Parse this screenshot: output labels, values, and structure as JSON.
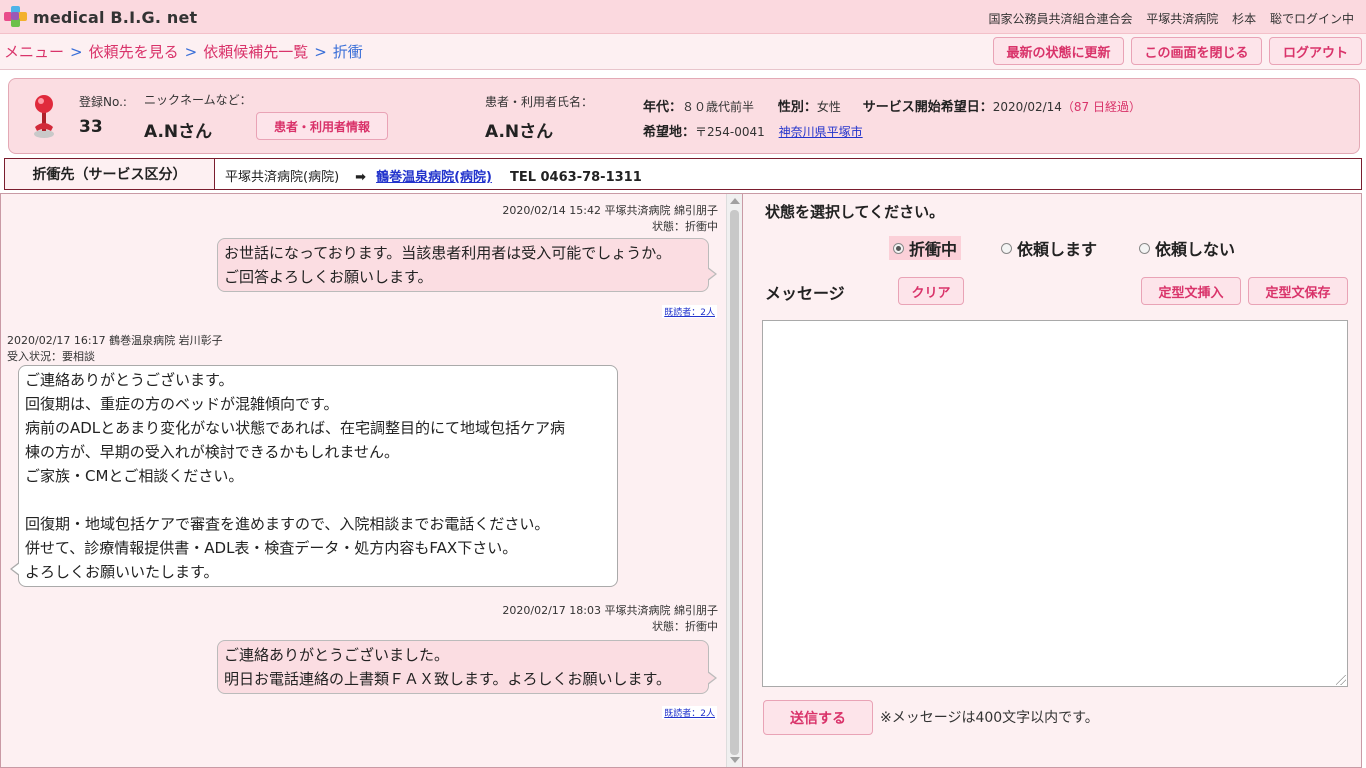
{
  "header": {
    "logo_text": "medical B.I.G. net",
    "org": "国家公務員共済組合連合会",
    "hospital": "平塚共済病院",
    "user": "杉本",
    "status": "聡でログイン中"
  },
  "breadcrumb": {
    "items": [
      "メニュー",
      "依頼先を見る",
      "依頼候補先一覧"
    ],
    "separator": ">",
    "current": "折衝"
  },
  "nav_buttons": {
    "refresh": "最新の状態に更新",
    "close": "この画面を閉じる",
    "logout": "ログアウト"
  },
  "patient": {
    "reg_label": "登録No.:",
    "reg_no": "33",
    "nick_label": "ニックネームなど：",
    "nickname": "A.Nさん",
    "info_button": "患者・利用者情報",
    "name_label": "患者・利用者氏名：",
    "name": "A.Nさん",
    "age_label": "年代：",
    "age": "８０歳代前半",
    "sex_label": "性別：",
    "sex": "女性",
    "start_label": "サービス開始希望日：",
    "start_date": "2020/02/14",
    "elapsed": "（87 日経過）",
    "place_label": "希望地：",
    "postal": "〒254-0041",
    "place": "神奈川県平塚市"
  },
  "negotiation": {
    "label": "折衝先（サービス区分）",
    "from": "平塚共済病院(病院)",
    "arrow": "➡",
    "to": "鶴巻温泉病院(病院)",
    "tel": "TEL 0463-78-1311"
  },
  "messages": [
    {
      "meta1": "2020/02/14 15:42  平塚共済病院 綿引朋子",
      "meta2": "状態：折衝中",
      "lines": [
        "お世話になっております。当該患者利用者は受入可能でしょうか。",
        "ご回答よろしくお願いします。"
      ],
      "readers": "既読者：2人"
    },
    {
      "meta1": "2020/02/17 16:17  鶴巻温泉病院 岩川彰子",
      "meta2": "受入状況：要相談",
      "lines": [
        "ご連絡ありがとうございます。",
        "回復期は、重症の方のベッドが混雑傾向です。",
        "病前のADLとあまり変化がない状態であれば、在宅調整目的にて地域包括ケア病",
        "棟の方が、早期の受入れが検討できるかもしれません。",
        "ご家族・CMとご相談ください。",
        "",
        "回復期・地域包括ケアで審査を進めますので、入院相談までお電話ください。",
        "併せて、診療情報提供書・ADL表・検査データ・処方内容もFAX下さい。",
        "よろしくお願いいたします。"
      ]
    },
    {
      "meta1": "2020/02/17 18:03  平塚共済病院 綿引朋子",
      "meta2": "状態：折衝中",
      "lines": [
        "ご連絡ありがとうございました。",
        "明日お電話連絡の上書類ＦＡＸ致します。よろしくお願いします。"
      ],
      "readers": "既読者：2人"
    }
  ],
  "reply": {
    "prompt": "状態を選択してください。",
    "options": [
      "折衝中",
      "依頼します",
      "依頼しない"
    ],
    "selected": "折衝中",
    "message_label": "メッセージ",
    "clear": "クリア",
    "insert_template": "定型文挿入",
    "save_template": "定型文保存",
    "message_value": "",
    "send": "送信する",
    "note": "※メッセージは400文字以内です。"
  },
  "colors": {
    "header_bg": "#fbd9df",
    "accent": "#d9336a",
    "link": "#2233cc",
    "panel_bg": "#fdf0f2",
    "bubble_out": "#fbdde2"
  }
}
